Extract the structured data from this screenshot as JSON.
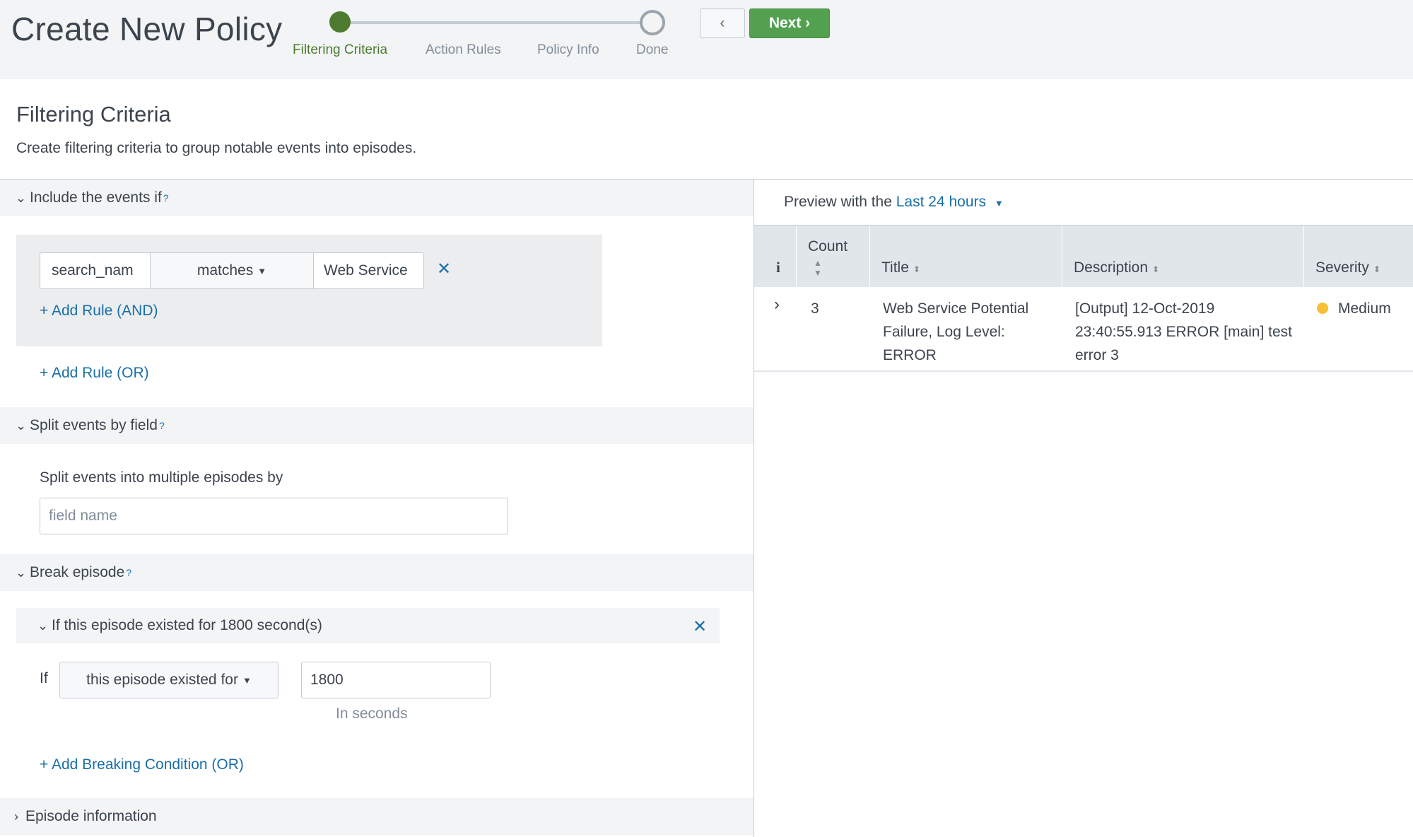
{
  "header": {
    "title": "Create New Policy",
    "steps": [
      "Filtering Criteria",
      "Action Rules",
      "Policy Info",
      "Done"
    ],
    "prev_label": "‹",
    "next_label": "Next ›",
    "colors": {
      "active_step": "#4c7a2e",
      "next_button": "#53a051",
      "link": "#1a6fa6"
    }
  },
  "section": {
    "title": "Filtering Criteria",
    "description": "Create filtering criteria to group notable events into episodes."
  },
  "include": {
    "header": "Include the events if",
    "help": "?",
    "rule": {
      "field": "search_nam",
      "operator": "matches",
      "value": "Web Service"
    },
    "remove_icon": "close-icon",
    "add_and": "+ Add Rule (AND)",
    "add_or": "+ Add Rule (OR)"
  },
  "split": {
    "header": "Split events by field",
    "help": "?",
    "label": "Split events into multiple episodes by",
    "placeholder": "field name"
  },
  "break": {
    "header": "Break episode",
    "help": "?",
    "condition_title": "If this episode existed for 1800 second(s)",
    "if_label": "If",
    "condition_select": "this episode existed for",
    "value": "1800",
    "hint": "In seconds",
    "add_condition": "+ Add Breaking Condition (OR)"
  },
  "episode_info": {
    "header": "Episode information"
  },
  "preview": {
    "prefix": "Preview with the",
    "range": "Last 24 hours",
    "columns": [
      "i",
      "Count",
      "Title",
      "Description",
      "Severity"
    ],
    "rows": [
      {
        "count": "3",
        "title": "Web Service Potential Failure, Log Level: ERROR",
        "description": "[Output] 12-Oct-2019 23:40:55.913 ERROR [main] test error 3",
        "severity": "Medium",
        "severity_color": "#f8be34"
      }
    ]
  }
}
